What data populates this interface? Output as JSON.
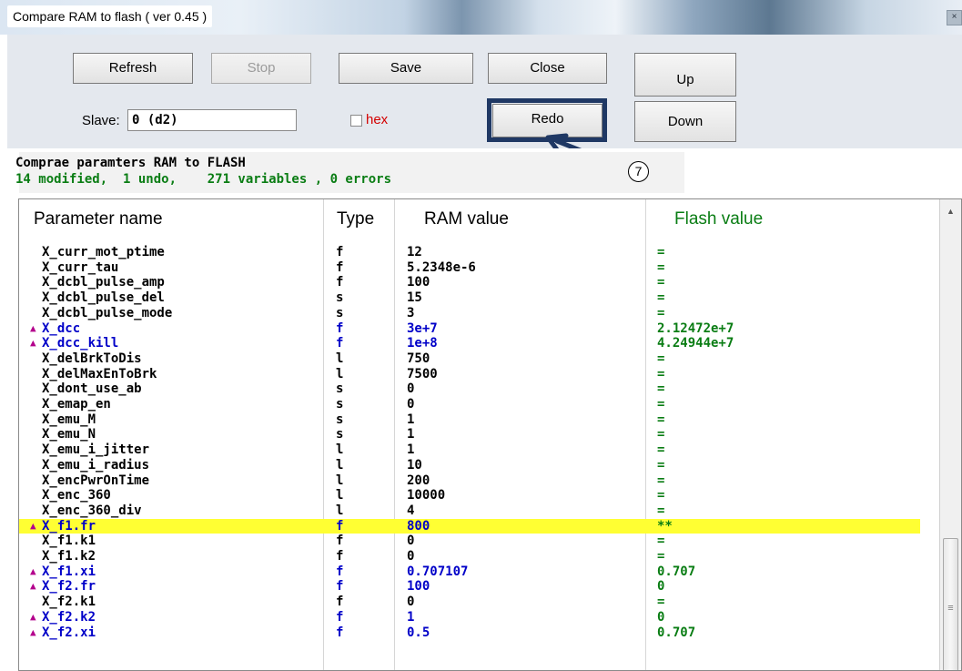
{
  "window": {
    "title": "Compare RAM to flash ( ver 0.45 )",
    "close_glyph": "×"
  },
  "toolbar": {
    "refresh": "Refresh",
    "stop": "Stop",
    "save": "Save",
    "close": "Close",
    "up": "Up",
    "redo": "Redo",
    "down": "Down",
    "slave_label": "Slave:",
    "slave_value": "0 (d2)",
    "hex_label": "hex",
    "hex_checked": false
  },
  "status": {
    "line1": "Comprae paramters RAM to FLASH",
    "line2": "14 modified,  1 undo,    271 variables , 0 errors",
    "line1_color": "#000000",
    "line2_color": "#0a7d14"
  },
  "annotation": {
    "marker": "7",
    "highlight_color": "#1f3864"
  },
  "table": {
    "headers": {
      "name": "Parameter name",
      "type": "Type",
      "ram": "RAM value",
      "flash": "Flash value",
      "flash_color": "#0a7d14"
    },
    "rows": [
      {
        "mark": "",
        "name": "X_curr_mot_ptime",
        "type": "f",
        "ram": "12",
        "flash": "=",
        "modified": false,
        "highlight": false
      },
      {
        "mark": "",
        "name": "X_curr_tau",
        "type": "f",
        "ram": "5.2348e-6",
        "flash": "=",
        "modified": false,
        "highlight": false
      },
      {
        "mark": "",
        "name": "X_dcbl_pulse_amp",
        "type": "f",
        "ram": "100",
        "flash": "=",
        "modified": false,
        "highlight": false
      },
      {
        "mark": "",
        "name": "X_dcbl_pulse_del",
        "type": "s",
        "ram": "15",
        "flash": "=",
        "modified": false,
        "highlight": false
      },
      {
        "mark": "",
        "name": "X_dcbl_pulse_mode",
        "type": "s",
        "ram": "3",
        "flash": "=",
        "modified": false,
        "highlight": false
      },
      {
        "mark": "▲",
        "name": "X_dcc",
        "type": "f",
        "ram": "3e+7",
        "flash": "2.12472e+7",
        "modified": true,
        "highlight": false
      },
      {
        "mark": "▲",
        "name": "X_dcc_kill",
        "type": "f",
        "ram": "1e+8",
        "flash": "4.24944e+7",
        "modified": true,
        "highlight": false
      },
      {
        "mark": "",
        "name": "X_delBrkToDis",
        "type": "l",
        "ram": "750",
        "flash": "=",
        "modified": false,
        "highlight": false
      },
      {
        "mark": "",
        "name": "X_delMaxEnToBrk",
        "type": "l",
        "ram": "7500",
        "flash": "=",
        "modified": false,
        "highlight": false
      },
      {
        "mark": "",
        "name": "X_dont_use_ab",
        "type": "s",
        "ram": "0",
        "flash": "=",
        "modified": false,
        "highlight": false
      },
      {
        "mark": "",
        "name": "X_emap_en",
        "type": "s",
        "ram": "0",
        "flash": "=",
        "modified": false,
        "highlight": false
      },
      {
        "mark": "",
        "name": "X_emu_M",
        "type": "s",
        "ram": "1",
        "flash": "=",
        "modified": false,
        "highlight": false
      },
      {
        "mark": "",
        "name": "X_emu_N",
        "type": "s",
        "ram": "1",
        "flash": "=",
        "modified": false,
        "highlight": false
      },
      {
        "mark": "",
        "name": "X_emu_i_jitter",
        "type": "l",
        "ram": "1",
        "flash": "=",
        "modified": false,
        "highlight": false
      },
      {
        "mark": "",
        "name": "X_emu_i_radius",
        "type": "l",
        "ram": "10",
        "flash": "=",
        "modified": false,
        "highlight": false
      },
      {
        "mark": "",
        "name": "X_encPwrOnTime",
        "type": "l",
        "ram": "200",
        "flash": "=",
        "modified": false,
        "highlight": false
      },
      {
        "mark": "",
        "name": "X_enc_360",
        "type": "l",
        "ram": "10000",
        "flash": "=",
        "modified": false,
        "highlight": false
      },
      {
        "mark": "",
        "name": "X_enc_360_div",
        "type": "l",
        "ram": "4",
        "flash": "=",
        "modified": false,
        "highlight": false
      },
      {
        "mark": "▲",
        "name": "X_f1.fr",
        "type": "f",
        "ram": "800",
        "flash": "**",
        "modified": true,
        "highlight": true
      },
      {
        "mark": "",
        "name": "X_f1.k1",
        "type": "f",
        "ram": "0",
        "flash": "=",
        "modified": false,
        "highlight": false
      },
      {
        "mark": "",
        "name": "X_f1.k2",
        "type": "f",
        "ram": "0",
        "flash": "=",
        "modified": false,
        "highlight": false
      },
      {
        "mark": "▲",
        "name": "X_f1.xi",
        "type": "f",
        "ram": "0.707107",
        "flash": "0.707",
        "modified": true,
        "highlight": false
      },
      {
        "mark": "▲",
        "name": "X_f2.fr",
        "type": "f",
        "ram": "100",
        "flash": "0",
        "modified": true,
        "highlight": false
      },
      {
        "mark": "",
        "name": "X_f2.k1",
        "type": "f",
        "ram": "0",
        "flash": "=",
        "modified": false,
        "highlight": false
      },
      {
        "mark": "▲",
        "name": "X_f2.k2",
        "type": "f",
        "ram": "1",
        "flash": "0",
        "modified": true,
        "highlight": false
      },
      {
        "mark": "▲",
        "name": "X_f2.xi",
        "type": "f",
        "ram": "0.5",
        "flash": "0.707",
        "modified": true,
        "highlight": false
      }
    ]
  },
  "scrollbar": {
    "up_glyph": "▲",
    "grip_glyph": "≡"
  }
}
